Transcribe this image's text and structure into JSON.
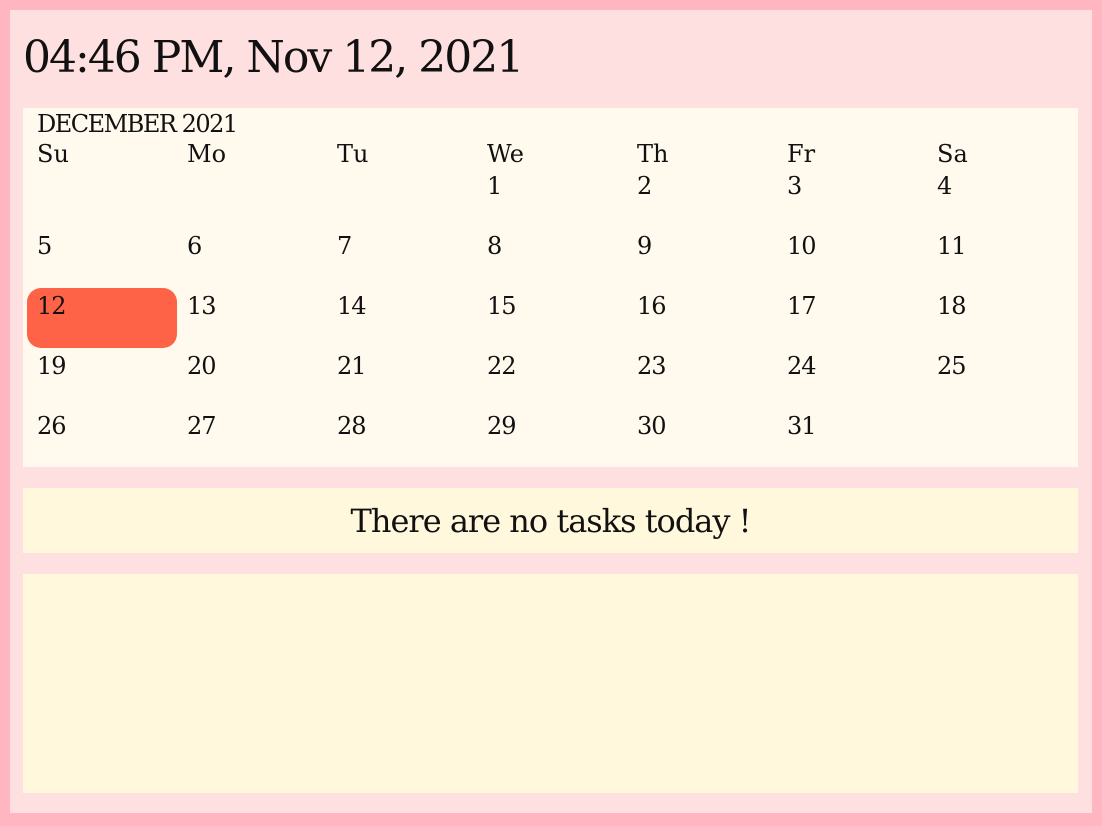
{
  "clock": {
    "datetime": "04:46 PM, Nov 12, 2021"
  },
  "calendar": {
    "month_title": "DECEMBER 2021",
    "weekdays": [
      "Su",
      "Mo",
      "Tu",
      "We",
      "Th",
      "Fr",
      "Sa"
    ],
    "selected_day": "12",
    "highlight_color": "#ff6347",
    "weeks": [
      [
        "",
        "",
        "",
        "1",
        "2",
        "3",
        "4"
      ],
      [
        "5",
        "6",
        "7",
        "8",
        "9",
        "10",
        "11"
      ],
      [
        "12",
        "13",
        "14",
        "15",
        "16",
        "17",
        "18"
      ],
      [
        "19",
        "20",
        "21",
        "22",
        "23",
        "24",
        "25"
      ],
      [
        "26",
        "27",
        "28",
        "29",
        "30",
        "31",
        ""
      ]
    ]
  },
  "tasks": {
    "empty_message": "There are no tasks today !"
  },
  "colors": {
    "outer_border": "#ffb6c1",
    "frame_background": "#ffe0e0",
    "calendar_background": "#fff9ee",
    "tasks_background": "#fff8dd"
  }
}
